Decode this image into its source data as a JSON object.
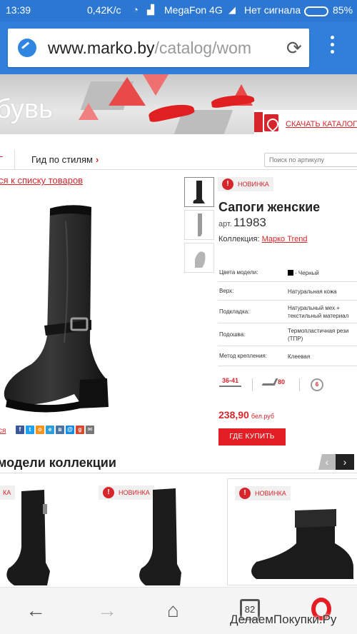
{
  "status_bar": {
    "time": "13:39",
    "speed": "0,42K/c",
    "carrier": "MegaFon 4G",
    "no_signal": "Нет сигнала",
    "battery": "85%"
  },
  "browser": {
    "url_host": "www.marko.by",
    "url_path": "/catalog/wom",
    "icons": [
      "speed-dial-icon",
      "reload-icon",
      "menu-dots-icon"
    ]
  },
  "banner": {
    "title": "бувь",
    "catalog_link": "СКАЧАТЬ КАТАЛОГ"
  },
  "nav": {
    "left_tab": "Г",
    "style_guide": "Гид по стилям",
    "style_guide_chevron": "›",
    "search_placeholder": "Поиск по артикулу"
  },
  "back_link": "ся к списку товаров",
  "product": {
    "badge": "НОВИНКА",
    "name": "Сапоги женские",
    "art_label": "арт.",
    "art_number": "11983",
    "collection_label": "Коллекция:",
    "collection_value": "Марко Trend",
    "specs": [
      {
        "key": "Цвета модели:",
        "value": "- Черный"
      },
      {
        "key": "Верх:",
        "value": "Натуральная кожа"
      },
      {
        "key": "Подкладка:",
        "value": "Натуральный мех +\nтекстильный материал"
      },
      {
        "key": "Подошва:",
        "value": "Термопластичная рези\n(ТПР)"
      },
      {
        "key": "Метод крепления:",
        "value": "Клеевая"
      }
    ],
    "size_range": "36-41",
    "heel_height": "80",
    "dial_value": "6",
    "price": "238,90",
    "currency": "бел.руб",
    "buy_button": "ГДЕ КУПИТЬ",
    "share_label": "ся"
  },
  "social_icons": [
    {
      "name": "facebook-icon",
      "glyph": "f",
      "color": "#3b5998"
    },
    {
      "name": "twitter-icon",
      "glyph": "t",
      "color": "#1da1f2"
    },
    {
      "name": "odnoklassniki-icon",
      "glyph": "o",
      "color": "#f7931e"
    },
    {
      "name": "livejournal-icon",
      "glyph": "e",
      "color": "#2d9ed8"
    },
    {
      "name": "vkontakte-icon",
      "glyph": "в",
      "color": "#4c75a3"
    },
    {
      "name": "mymail-icon",
      "glyph": "@",
      "color": "#168de2"
    },
    {
      "name": "googleplus-icon",
      "glyph": "g",
      "color": "#d6492f"
    },
    {
      "name": "email-icon",
      "glyph": "✉",
      "color": "#777777"
    }
  ],
  "collection": {
    "title": "модели коллекции",
    "prev": "‹",
    "next": "›",
    "cards": [
      {
        "badge": "КА"
      },
      {
        "badge": "НОВИНКА"
      },
      {
        "badge": "НОВИНКА"
      }
    ]
  },
  "bottom_nav": {
    "tabs_count": "82",
    "icons": [
      "back-icon",
      "forward-icon",
      "home-icon",
      "tabs-icon",
      "opera-icon"
    ]
  },
  "watermark": "ДелаемПокупки.Ру",
  "colors": {
    "brand_red": "#e31e24",
    "browser_blue": "#2f7fdb"
  }
}
